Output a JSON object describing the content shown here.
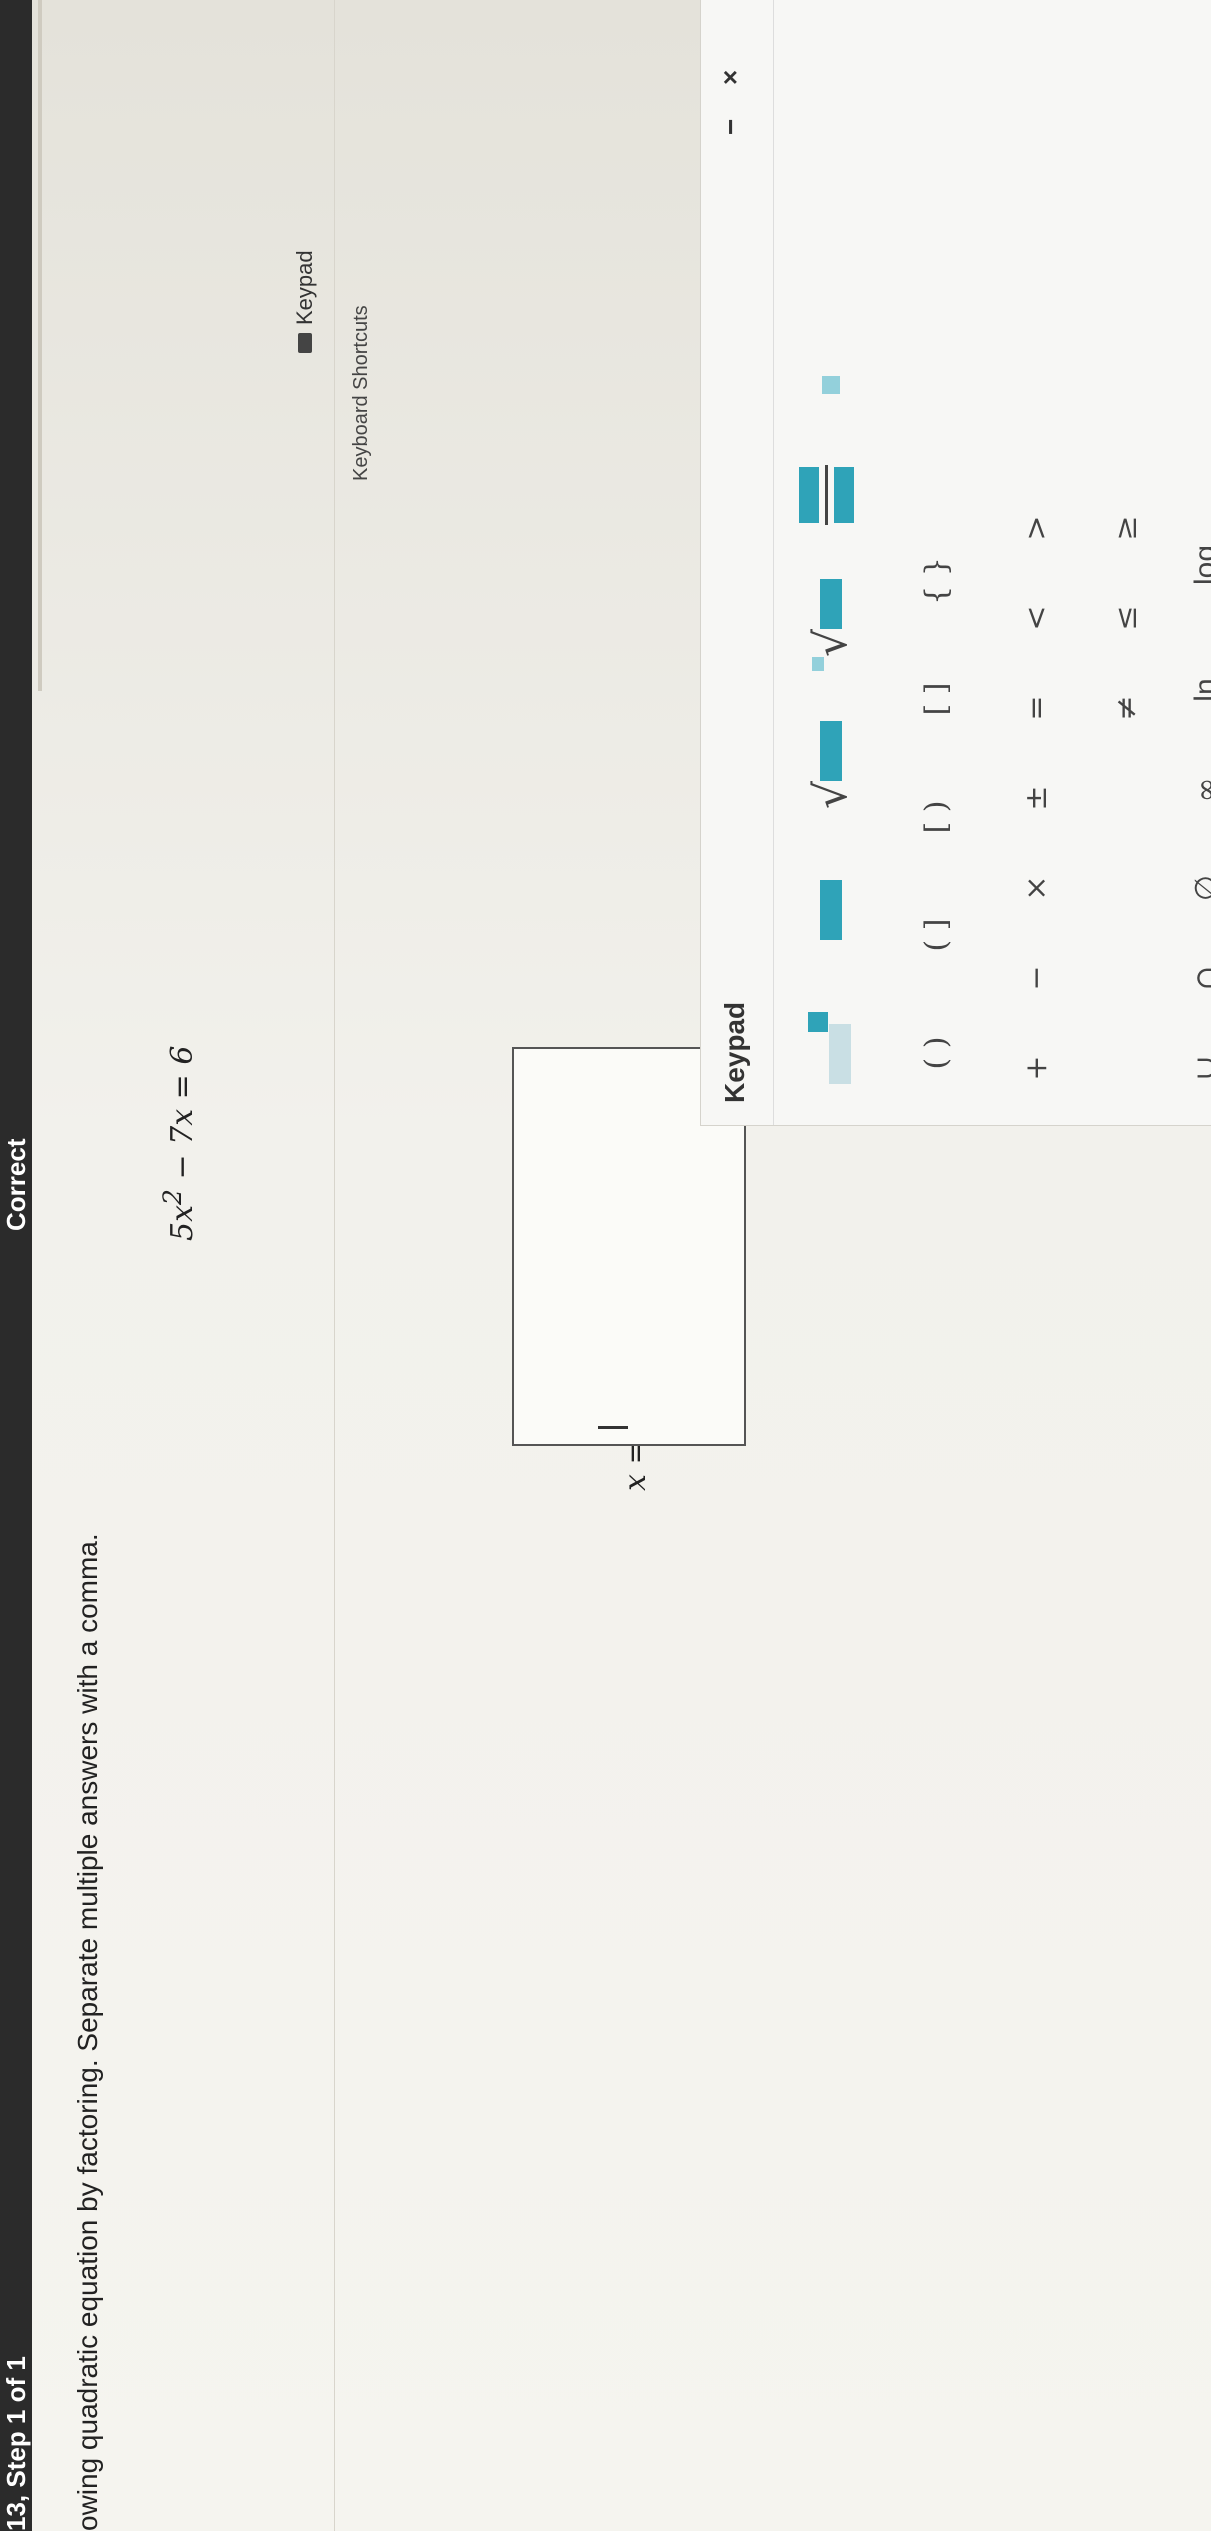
{
  "header": {
    "step_label": "13, Step 1 of 1",
    "status": "Correct"
  },
  "question": {
    "instruction": "owing quadratic equation by factoring. Separate multiple answers with a comma.",
    "equation": "5x² − 7x = 6"
  },
  "answer": {
    "variable_label": "x =",
    "value": ""
  },
  "keypad_toggle": {
    "label": "Keypad",
    "shortcuts_link": "Keyboard Shortcuts"
  },
  "keypad": {
    "title": "Keypad",
    "minimize": "−",
    "close": "×",
    "template_keys": [
      "superscript",
      "subscript",
      "square root",
      "nth root",
      "fraction",
      "mixed number"
    ],
    "group_keys": [
      "( )",
      "( ]",
      "[ )",
      "[ ]",
      "{ }"
    ],
    "operator_keys": [
      "+",
      "−",
      "×",
      "±",
      "=",
      "<",
      ">"
    ],
    "relation_keys": [
      "≠",
      "≤",
      "≥"
    ],
    "set_keys": [
      "∪",
      "∩",
      "∅"
    ],
    "function_keys": [
      "∞",
      "ln",
      "log"
    ]
  },
  "colors": {
    "accent": "#2fa3b8",
    "header_bg": "#2b2b2b"
  }
}
